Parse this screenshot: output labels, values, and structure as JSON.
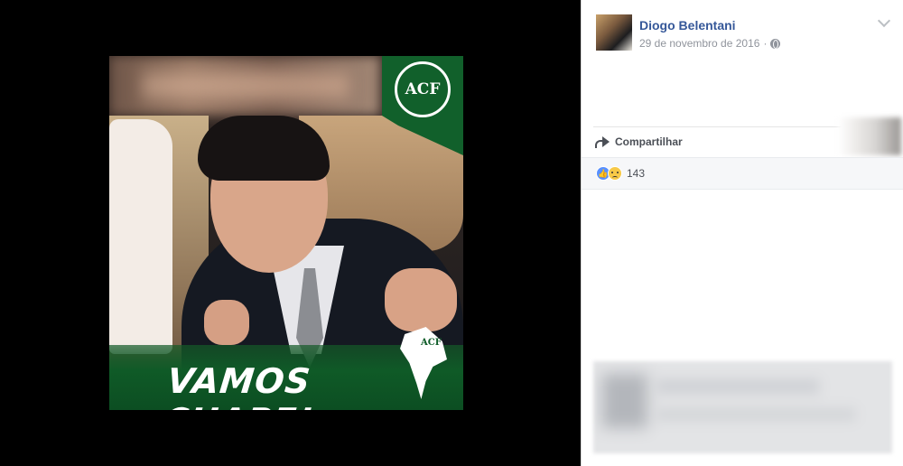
{
  "photo": {
    "slogan": "VAMOS CHAPE!",
    "logo_text": "ACF",
    "map_logo_text": "ACF"
  },
  "post": {
    "author": "Diogo Belentani",
    "date": "29 de novembro de 2016",
    "separator": "·",
    "privacy_icon": "globe-icon"
  },
  "actions": {
    "share_label": "Compartilhar",
    "share_icon": "share-arrow-icon"
  },
  "reactions": {
    "icons": [
      "like-icon",
      "sad-icon"
    ],
    "count": "143",
    "like_glyph": "👍"
  },
  "colors": {
    "link": "#365899",
    "meta": "#90949c",
    "brand_green": "#0f5a27",
    "like_blue": "#5890ff"
  }
}
